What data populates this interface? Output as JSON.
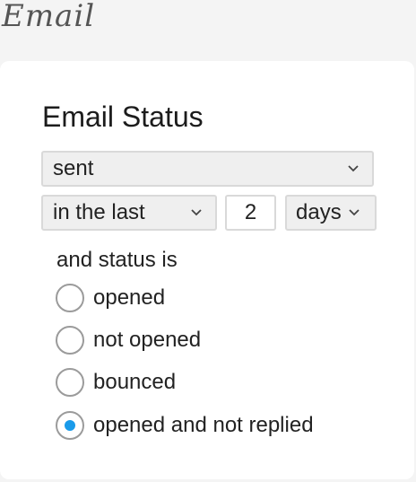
{
  "section": {
    "label": "Email"
  },
  "card": {
    "title": "Email Status",
    "status_select": {
      "value": "sent",
      "icon": "chevron-down-icon"
    },
    "range_select": {
      "value": "in the last",
      "icon": "chevron-down-icon"
    },
    "count_input": {
      "value": "2"
    },
    "unit_select": {
      "value": "days",
      "icon": "chevron-down-icon"
    },
    "status_label": "and status is",
    "options": [
      {
        "label": "opened",
        "checked": false
      },
      {
        "label": "not opened",
        "checked": false
      },
      {
        "label": "bounced",
        "checked": false
      },
      {
        "label": "opened and not replied",
        "checked": true
      }
    ],
    "accent_color": "#1a9bea"
  }
}
